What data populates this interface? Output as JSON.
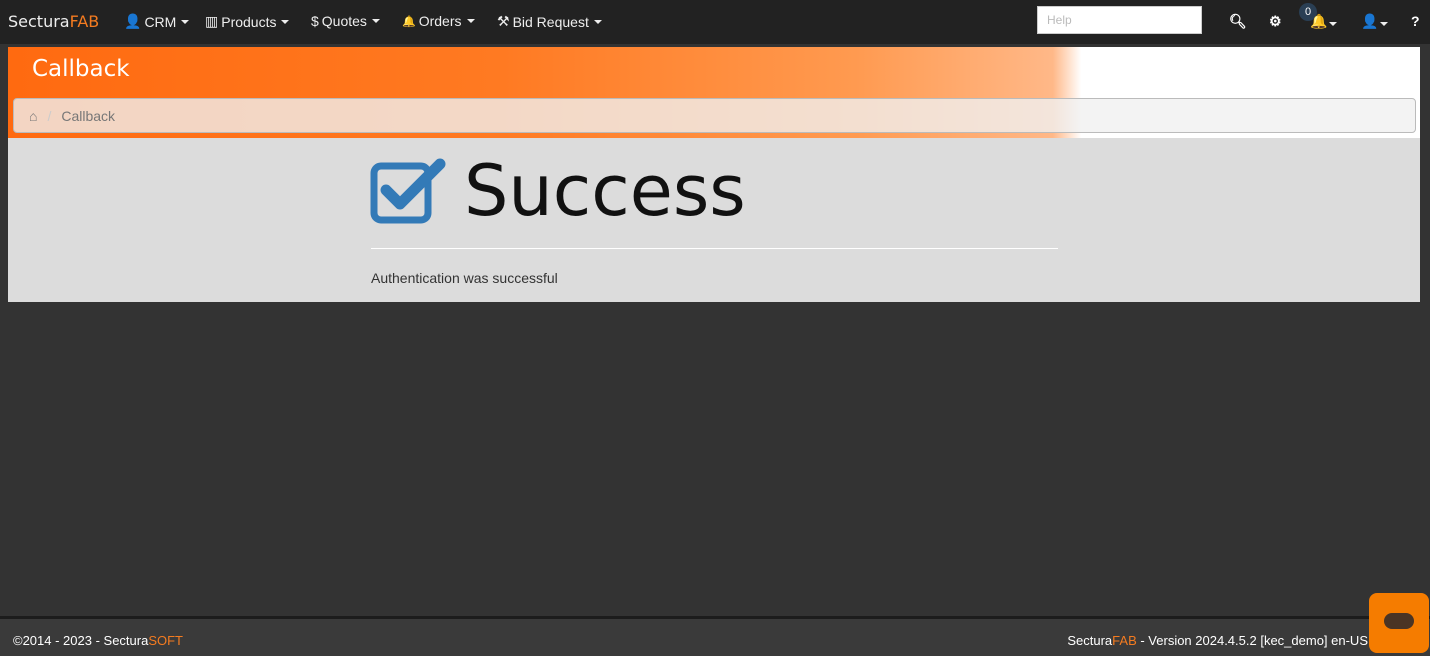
{
  "nav": {
    "brand_a": "Sectura",
    "brand_b": "FAB",
    "menus": [
      {
        "icon": "user-icon",
        "glyph": "👤",
        "label": "CRM"
      },
      {
        "icon": "barcode-icon",
        "glyph": "▥",
        "label": "Products"
      },
      {
        "icon": "dollar-icon",
        "glyph": "$",
        "label": "Quotes"
      },
      {
        "icon": "bell-icon",
        "glyph": "🔔",
        "label": "Orders"
      },
      {
        "icon": "gavel-icon",
        "glyph": "⚒",
        "label": "Bid Request"
      }
    ],
    "help_placeholder": "Help",
    "notif_count": "0",
    "question": "?"
  },
  "page": {
    "title": "Callback",
    "breadcrumb": [
      "Callback"
    ],
    "success": "Success",
    "message": "Authentication was successful"
  },
  "footer": {
    "copyright": "©2014 - 2023 - Sectura",
    "copy_brand": "SOFT",
    "brand_a": "Sectura",
    "brand_b": "FAB",
    "version": " - Version 2024.4.5.2 [kec_demo] en-US"
  },
  "colors": {
    "accent": "#f47b20",
    "success_icon": "#337ab7"
  }
}
